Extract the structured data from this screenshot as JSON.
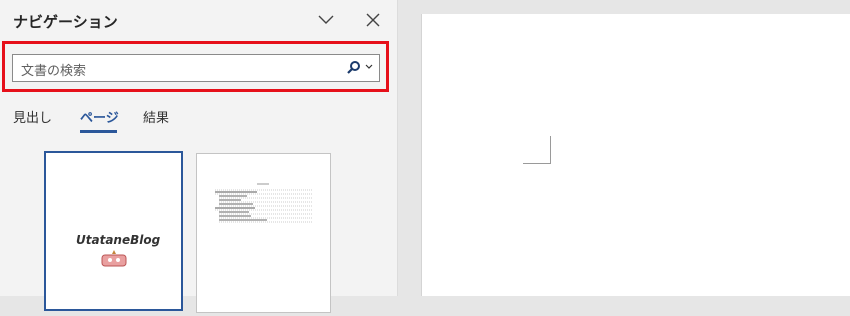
{
  "nav": {
    "title": "ナビゲーション",
    "search": {
      "placeholder": "文書の検索"
    },
    "tabs": [
      {
        "label": "見出し",
        "active": false
      },
      {
        "label": "ページ",
        "active": true
      },
      {
        "label": "結果",
        "active": false
      }
    ],
    "thumbnails": [
      {
        "page": 1,
        "selected": true,
        "title_text": "UtataneBlog"
      },
      {
        "page": 2,
        "selected": false
      }
    ]
  },
  "colors": {
    "accent": "#2b579a",
    "highlight": "#e6101a"
  },
  "icons": {
    "collapse": "chevron-down-icon",
    "close": "close-icon",
    "search": "search-icon",
    "search_options": "chevron-down-icon"
  }
}
